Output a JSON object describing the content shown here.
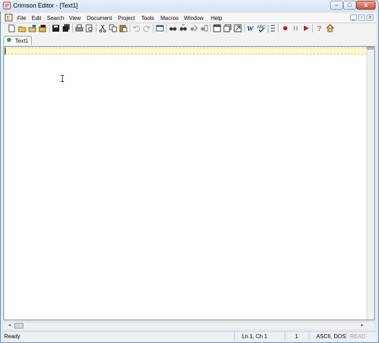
{
  "window": {
    "title": "Crimson Editor - [Text1]"
  },
  "caption_buttons": {
    "minimize": "–",
    "maximize": "□",
    "close": "x"
  },
  "menu": {
    "items": [
      "File",
      "Edit",
      "Search",
      "View",
      "Document",
      "Project",
      "Tools",
      "Macros",
      "Window",
      "Help"
    ],
    "mdi_buttons": [
      "_",
      "▫",
      "x"
    ]
  },
  "toolbar": {
    "icons": [
      "new-file-icon",
      "open-folder-icon",
      "open-remote-icon",
      "open-icon",
      "save-icon",
      "save-all-icon",
      "print-icon",
      "print-preview-icon",
      "cut-icon",
      "copy-icon",
      "paste-icon",
      "undo-icon",
      "redo-icon",
      "view-icon",
      "find-icon",
      "find-next-icon",
      "replace-icon",
      "find-in-files-icon",
      "window-icon",
      "window-stack-icon",
      "goto-icon",
      "word-wrap-icon",
      "spell-check-icon",
      "list-icon",
      "record-icon",
      "pause-icon",
      "play-icon",
      "help-icon",
      "home-icon"
    ]
  },
  "tabs": [
    {
      "label": "Text1",
      "dot_color": "#3c9b3c"
    }
  ],
  "editor": {
    "current_line_color": "#fffbcc"
  },
  "status": {
    "message": "Ready",
    "position": "Ln 1, Ch 1",
    "column": "1",
    "encoding": "ASCII, DOS",
    "mode": "READ"
  }
}
